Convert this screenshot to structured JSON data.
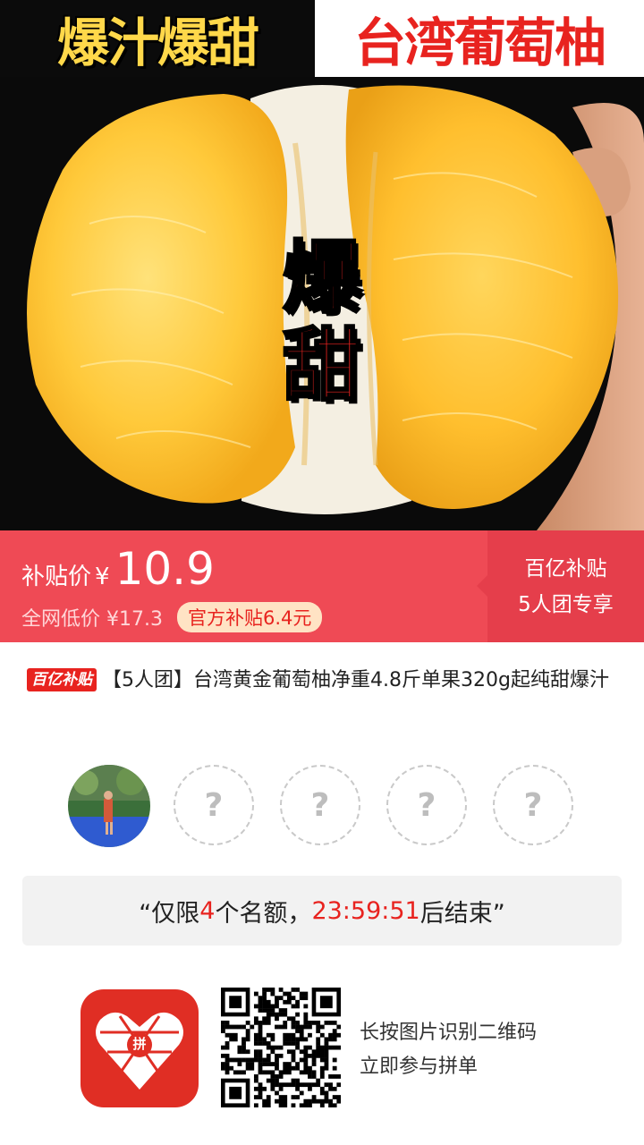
{
  "hero": {
    "title_left": "爆汁爆甜",
    "title_right": "台湾葡萄柚",
    "center_chars": [
      "爆",
      "甜"
    ]
  },
  "price_bar": {
    "label": "补贴价",
    "currency": "¥",
    "price": "10.9",
    "market_price": "全网低价 ¥17.3",
    "subsidy": "官方补贴6.4元",
    "side_line1": "百亿补贴",
    "side_line2": "5人团专享"
  },
  "product": {
    "badge": "百亿补贴",
    "title": "【5人团】台湾黄金葡萄柚净重4.8斤单果320g起纯甜爆汁"
  },
  "group": {
    "placeholder_mark": "?",
    "empty_slots": 4
  },
  "countdown": {
    "prefix": "“仅限",
    "count": "4",
    "middle": "个名额，",
    "time": "23:59:51",
    "suffix": "后结束”"
  },
  "footer": {
    "logo_char": "拼",
    "line1": "长按图片识别二维码",
    "line2": "立即参与拼单"
  },
  "colors": {
    "accent_red": "#ef4a55",
    "brand_red": "#e02e24",
    "subsidy_bg": "#ffe3c4"
  }
}
